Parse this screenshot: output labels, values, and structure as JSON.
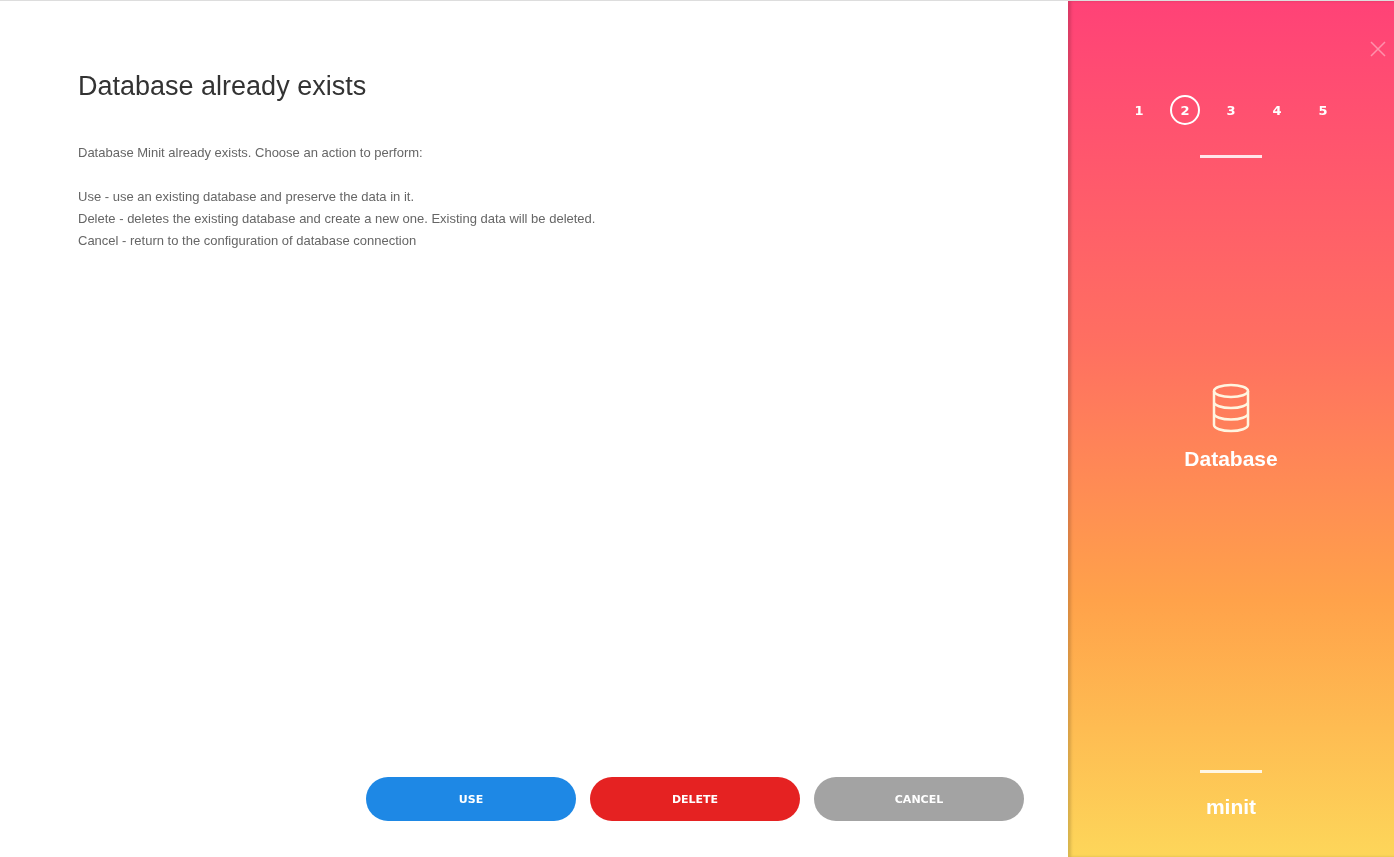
{
  "dialog": {
    "title": "Database already exists",
    "intro": "Database Minit already exists. Choose an action to perform:",
    "options": [
      "Use - use an existing database and preserve the data in it.",
      "Delete - deletes the existing database and create a new one. Existing data will be deleted.",
      "Cancel - return to the configuration of database connection"
    ]
  },
  "buttons": [
    {
      "label": "USE",
      "kind": "primary"
    },
    {
      "label": "DELETE",
      "kind": "danger"
    },
    {
      "label": "CANCEL",
      "kind": "neutral"
    }
  ],
  "sidebar": {
    "steps": [
      {
        "label": "1",
        "selected": false
      },
      {
        "label": "2",
        "selected": true
      },
      {
        "label": "3",
        "selected": false
      },
      {
        "label": "4",
        "selected": false
      },
      {
        "label": "5",
        "selected": false
      }
    ],
    "section": "Database",
    "brand": "minit"
  }
}
